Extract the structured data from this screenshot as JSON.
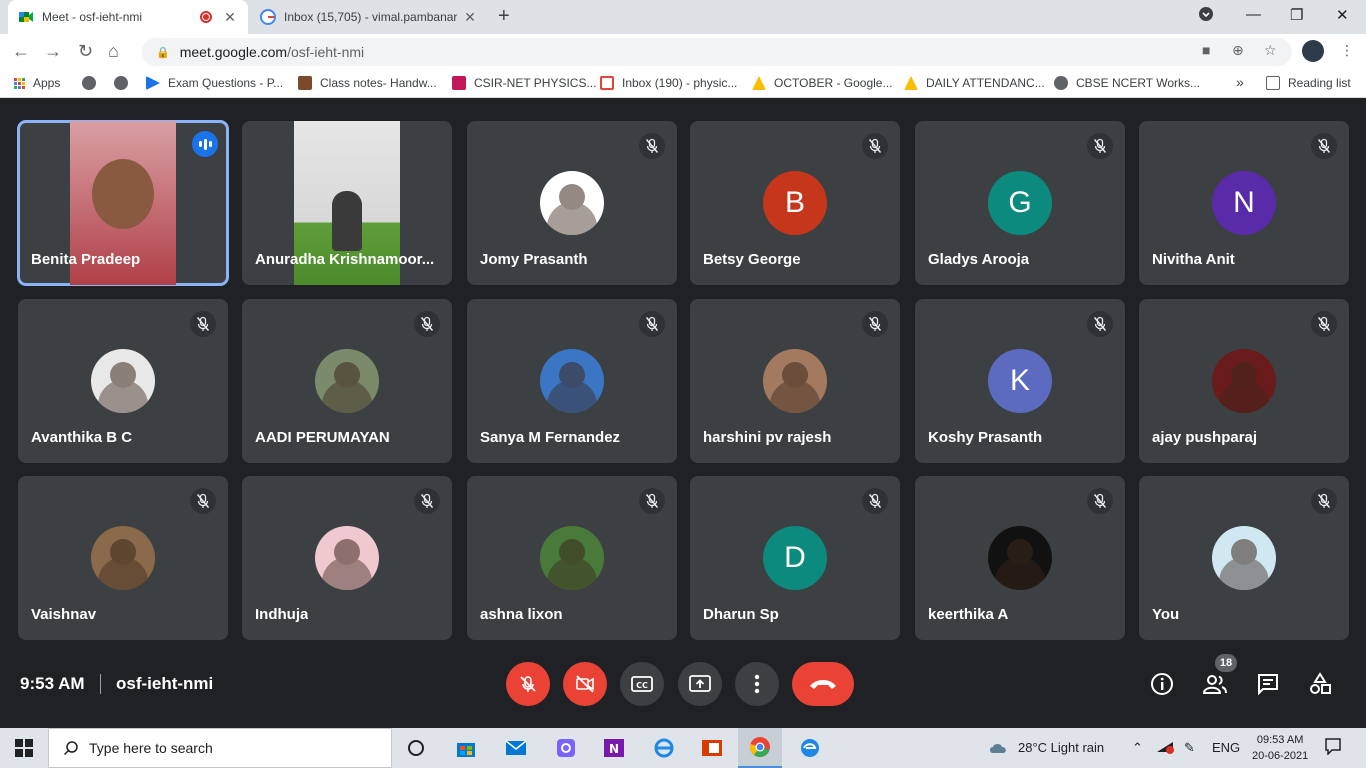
{
  "browser": {
    "tabs": [
      {
        "title": "Meet - osf-ieht-nmi",
        "active": true
      },
      {
        "title": "Inbox (15,705) - vimal.pambanar",
        "active": false
      }
    ],
    "url_host": "meet.google.com",
    "url_path": "/osf-ieht-nmi",
    "bookmarks": [
      {
        "label": "Apps",
        "icon": "apps-icon"
      },
      {
        "label": "",
        "icon": "globe-icon"
      },
      {
        "label": "",
        "icon": "globe-icon"
      },
      {
        "label": "Exam Questions - P...",
        "icon": "bookmark-icon"
      },
      {
        "label": "Class notes- Handw...",
        "icon": "bookmark-icon"
      },
      {
        "label": "CSIR-NET PHYSICS...",
        "icon": "bookmark-icon"
      },
      {
        "label": "Inbox (190) - physic...",
        "icon": "gmail-icon"
      },
      {
        "label": "OCTOBER - Google...",
        "icon": "drive-icon"
      },
      {
        "label": "DAILY ATTENDANC...",
        "icon": "drive-icon"
      },
      {
        "label": "CBSE NCERT Works...",
        "icon": "globe-icon"
      }
    ],
    "more_bookmarks": "»",
    "reading_list": "Reading list"
  },
  "participants": [
    {
      "name": "Benita Pradeep",
      "kind": "video",
      "speaking": true
    },
    {
      "name": "Anuradha Krishnamoor...",
      "kind": "video"
    },
    {
      "name": "Jomy Prasanth",
      "kind": "photo",
      "color": "#ffffff"
    },
    {
      "name": "Betsy George",
      "kind": "letter",
      "letter": "B",
      "color": "#c5361b"
    },
    {
      "name": "Gladys Arooja",
      "kind": "letter",
      "letter": "G",
      "color": "#0b8a7d"
    },
    {
      "name": "Nivitha Anit",
      "kind": "letter",
      "letter": "N",
      "color": "#5a2ba8"
    },
    {
      "name": "Avanthika B C",
      "kind": "photo",
      "color": "#e8e8e8"
    },
    {
      "name": "AADI PERUMAYAN",
      "kind": "photo",
      "color": "#7a8a6a"
    },
    {
      "name": "Sanya M Fernandez",
      "kind": "photo",
      "color": "#3a76c4"
    },
    {
      "name": "harshini pv rajesh",
      "kind": "photo",
      "color": "#a37a60"
    },
    {
      "name": "Koshy Prasanth",
      "kind": "letter",
      "letter": "K",
      "color": "#5c6bc0"
    },
    {
      "name": "ajay pushparaj",
      "kind": "photo",
      "color": "#6a1b1b"
    },
    {
      "name": "Vaishnav",
      "kind": "photo",
      "color": "#8a6a4a"
    },
    {
      "name": "Indhuja",
      "kind": "photo",
      "color": "#f0c8d0"
    },
    {
      "name": "ashna lixon",
      "kind": "photo",
      "color": "#4a7a3a"
    },
    {
      "name": "Dharun Sp",
      "kind": "letter",
      "letter": "D",
      "color": "#0b8a7d"
    },
    {
      "name": "keerthika A",
      "kind": "photo",
      "color": "#111111"
    },
    {
      "name": "You",
      "kind": "photo",
      "color": "#cfe8f2"
    }
  ],
  "meeting": {
    "time": "9:53 AM",
    "separator": "|",
    "code": "osf-ieht-nmi",
    "participant_count": "18"
  },
  "taskbar": {
    "search_placeholder": "Type here to search",
    "weather": "28°C  Light rain",
    "language": "ENG",
    "clock_time": "09:53 AM",
    "clock_date": "20-06-2021"
  }
}
